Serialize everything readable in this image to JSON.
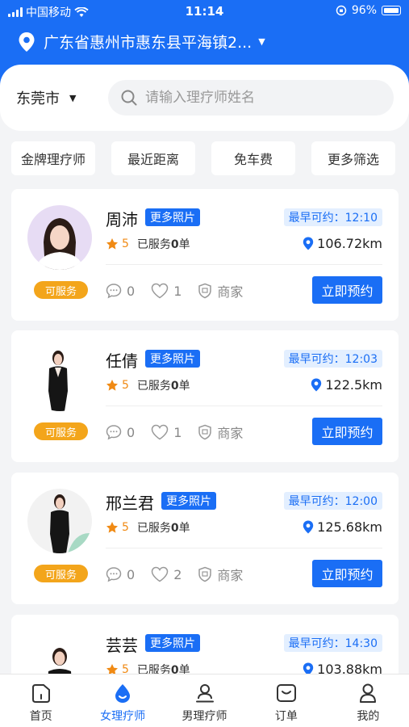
{
  "status_bar": {
    "carrier": "中国移动",
    "time": "11:14",
    "battery": "96%"
  },
  "location": {
    "address": "广东省惠州市惠东县平海镇2...",
    "icon": "location-pin-icon"
  },
  "search": {
    "city": "东莞市",
    "placeholder": "请输入理疗师姓名"
  },
  "filters": [
    "金牌理疗师",
    "最近距离",
    "免车费",
    "更多筛选"
  ],
  "therapists": [
    {
      "name": "周沛",
      "more_photos": "更多照片",
      "earliest": "最早可约：12:10",
      "score": "5",
      "served_prefix": "已服务",
      "served_count": "0",
      "served_suffix": "单",
      "distance": "106.72km",
      "comments": "0",
      "likes": "1",
      "merchant": "商家",
      "status": "可服务",
      "book": "立即预约"
    },
    {
      "name": "任倩",
      "more_photos": "更多照片",
      "earliest": "最早可约：12:03",
      "score": "5",
      "served_prefix": "已服务",
      "served_count": "0",
      "served_suffix": "单",
      "distance": "122.5km",
      "comments": "0",
      "likes": "1",
      "merchant": "商家",
      "status": "可服务",
      "book": "立即预约"
    },
    {
      "name": "邢兰君",
      "more_photos": "更多照片",
      "earliest": "最早可约：12:00",
      "score": "5",
      "served_prefix": "已服务",
      "served_count": "0",
      "served_suffix": "单",
      "distance": "125.68km",
      "comments": "0",
      "likes": "2",
      "merchant": "商家",
      "status": "可服务",
      "book": "立即预约"
    },
    {
      "name": "芸芸",
      "more_photos": "更多照片",
      "earliest": "最早可约：14:30",
      "score": "5",
      "served_prefix": "已服务",
      "served_count": "0",
      "served_suffix": "单",
      "distance": "103.88km"
    }
  ],
  "tabbar": [
    {
      "label": "首页",
      "icon": "home-icon"
    },
    {
      "label": "女理疗师",
      "icon": "drop-icon",
      "active": true
    },
    {
      "label": "男理疗师",
      "icon": "male-therapist-icon"
    },
    {
      "label": "订单",
      "icon": "order-icon"
    },
    {
      "label": "我的",
      "icon": "profile-icon"
    }
  ],
  "colors": {
    "primary": "#1a6ef5",
    "status": "#f3a51b",
    "star": "#f08a14",
    "background": "#f3f4f6"
  }
}
